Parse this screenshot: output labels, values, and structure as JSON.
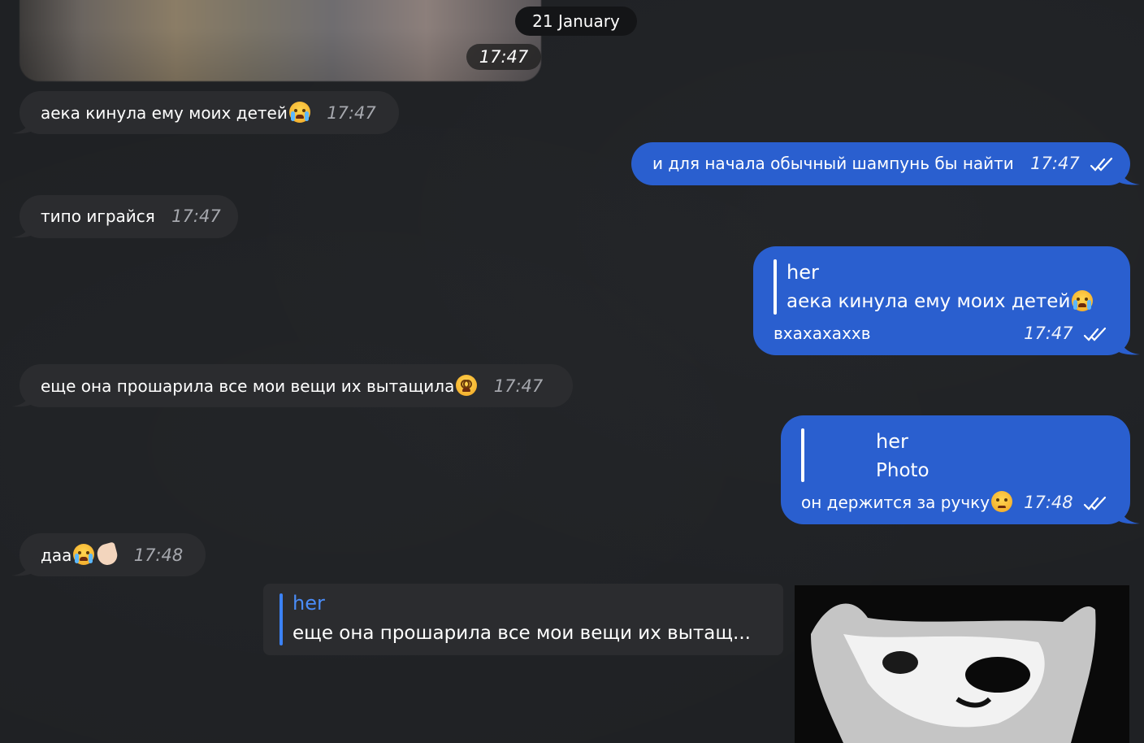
{
  "date_separator": "21 January",
  "photo_time": "17:47",
  "messages": [
    {
      "id": "m1",
      "side": "in",
      "text": "аека кинула ему моих детей",
      "emoji": "loudly-crying-face",
      "time": "17:47"
    },
    {
      "id": "m2",
      "side": "out",
      "text": "и для начала обычный шампунь бы найти",
      "time": "17:47"
    },
    {
      "id": "m3",
      "side": "in",
      "text": "типо играйся",
      "time": "17:47"
    },
    {
      "id": "m4",
      "side": "out",
      "reply_name": "her",
      "reply_text": "аека кинула ему моих детей",
      "reply_emoji": "loudly-crying-face",
      "text": "вхахахаххв",
      "time": "17:47"
    },
    {
      "id": "m5",
      "side": "in",
      "text": "еще она прошарила все мои вещи их вытащила",
      "emoji": "face-with-spiral-eyes",
      "time": "17:47"
    },
    {
      "id": "m6",
      "side": "out",
      "reply_name": "her",
      "reply_text": "Photo",
      "text": "он держится за ручку",
      "emoji": "face-holding-back-tears",
      "time": "17:48"
    },
    {
      "id": "m7",
      "side": "in",
      "text": "даа",
      "emoji": "loudly-crying-face",
      "emoji2": "pinching-hand",
      "time": "17:48"
    }
  ],
  "reply_card": {
    "name": "her",
    "text": "еще она прошарила все мои вещи их вытащ..."
  },
  "colors": {
    "background": "#1f2124",
    "incoming": "#2b2c2f",
    "outgoing": "#2a5fcf",
    "reply_accent": "#4a8cf7"
  }
}
